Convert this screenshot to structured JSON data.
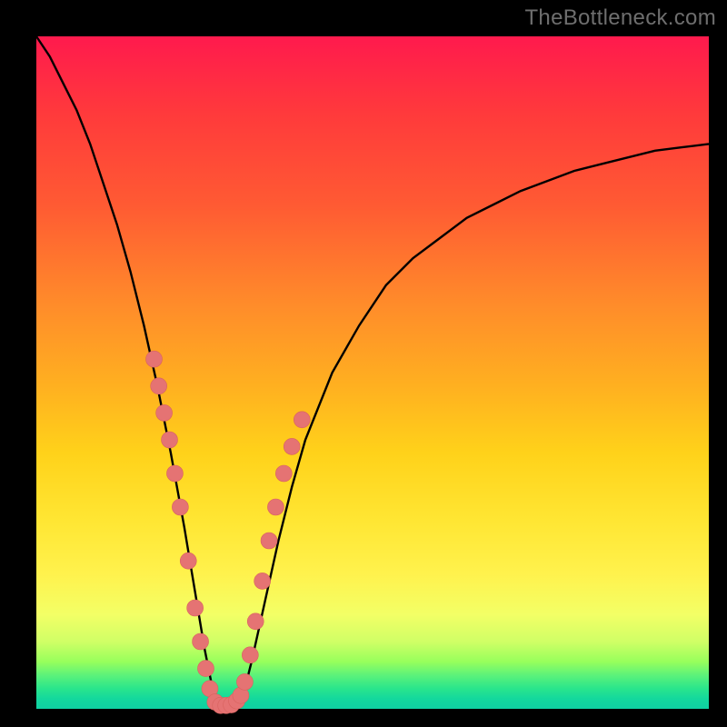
{
  "watermark": "TheBottleneck.com",
  "colors": {
    "gradient_top": "#ff1a4d",
    "gradient_mid": "#ffd21a",
    "gradient_bottom": "#0fd0a2",
    "curve": "#000000",
    "dots": "#e57373",
    "frame": "#000000"
  },
  "chart_data": {
    "type": "line",
    "title": "",
    "xlabel": "",
    "ylabel": "",
    "xlim": [
      0,
      100
    ],
    "ylim": [
      0,
      100
    ],
    "x": [
      0,
      2,
      4,
      6,
      8,
      10,
      12,
      14,
      16,
      18,
      20,
      22,
      24,
      25,
      26,
      27,
      28,
      29,
      30,
      31,
      32,
      34,
      36,
      38,
      40,
      44,
      48,
      52,
      56,
      60,
      64,
      68,
      72,
      76,
      80,
      84,
      88,
      92,
      96,
      100
    ],
    "values": [
      100,
      97,
      93,
      89,
      84,
      78,
      72,
      65,
      57,
      48,
      38,
      27,
      15,
      9,
      4,
      1,
      0,
      0,
      1,
      3,
      7,
      16,
      25,
      33,
      40,
      50,
      57,
      63,
      67,
      70,
      73,
      75,
      77,
      78.5,
      80,
      81,
      82,
      83,
      83.5,
      84
    ],
    "annotations": {
      "dots_region": "clustered along both arms roughly between y=6 and y=36",
      "dot_points_left_arm": [
        {
          "x": 17.5,
          "y": 52
        },
        {
          "x": 18.2,
          "y": 48
        },
        {
          "x": 19.0,
          "y": 44
        },
        {
          "x": 19.8,
          "y": 40
        },
        {
          "x": 20.6,
          "y": 35
        },
        {
          "x": 21.4,
          "y": 30
        },
        {
          "x": 22.6,
          "y": 22
        },
        {
          "x": 23.6,
          "y": 15
        },
        {
          "x": 24.4,
          "y": 10
        },
        {
          "x": 25.2,
          "y": 6
        },
        {
          "x": 25.8,
          "y": 3
        }
      ],
      "dot_points_right_arm": [
        {
          "x": 31.0,
          "y": 4
        },
        {
          "x": 31.8,
          "y": 8
        },
        {
          "x": 32.6,
          "y": 13
        },
        {
          "x": 33.6,
          "y": 19
        },
        {
          "x": 34.6,
          "y": 25
        },
        {
          "x": 35.6,
          "y": 30
        },
        {
          "x": 36.8,
          "y": 35
        },
        {
          "x": 38.0,
          "y": 39
        },
        {
          "x": 39.5,
          "y": 43
        }
      ],
      "dot_points_bottom": [
        {
          "x": 26.6,
          "y": 1
        },
        {
          "x": 27.4,
          "y": 0.5
        },
        {
          "x": 28.2,
          "y": 0.5
        },
        {
          "x": 29.0,
          "y": 0.6
        },
        {
          "x": 29.8,
          "y": 1.2
        },
        {
          "x": 30.4,
          "y": 2
        }
      ]
    }
  }
}
